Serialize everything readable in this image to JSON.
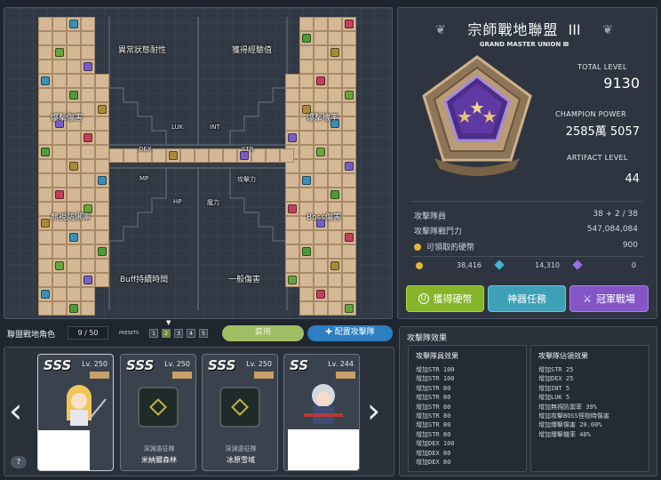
{
  "board": {
    "zones": {
      "abnormal_resist": "異常狀態耐性",
      "exp_gain": "獲得經驗值",
      "crit_damage": "爆擊傷害",
      "crit_rate": "爆擊機率",
      "luk": "LUK",
      "int": "INT",
      "dex": "DEX",
      "str": "STR",
      "mp": "MP",
      "atk": "攻擊力",
      "hp": "HP",
      "matk": "魔力",
      "ignore_def": "無視防禦率",
      "boss_damage": "Boss傷害",
      "buff_duration": "Buff持續時間",
      "normal_damage": "一般傷害"
    }
  },
  "union": {
    "title": "宗師戰地聯盟",
    "rank_numeral": "III",
    "subtitle": "GRAND MASTER UNION Ⅲ",
    "total_level_label": "TOTAL LEVEL",
    "total_level": "9130",
    "champion_power_label": "CHAMPION POWER",
    "champion_power": "2585萬 5057",
    "artifact_level_label": "ARTIFACT LEVEL",
    "artifact_level": "44"
  },
  "stats": {
    "members_label": "攻擊隊員",
    "members_value": "38 + 2 / 38",
    "power_label": "攻擊隊戰鬥力",
    "power_value": "547,084,084",
    "coins_label": "可領取的硬幣",
    "coins_value": "900",
    "currency_1": "38,416",
    "currency_2": "14,310",
    "currency_3": "0"
  },
  "buttons": {
    "get_coins": "獲得硬幣",
    "artifact_quest": "神器任務",
    "champion_battle": "冠軍戰場",
    "apply": "套用",
    "arrange": "配置攻擊隊"
  },
  "char_bar": {
    "label": "聯盟戰地角色",
    "count": "9 / 50",
    "presets_label": "PRESETS",
    "presets": [
      "1",
      "2",
      "3",
      "4",
      "5"
    ]
  },
  "cards": [
    {
      "grade": "SSS",
      "level": "Lv. 250",
      "subtitle": "",
      "name": ""
    },
    {
      "grade": "SSS",
      "level": "Lv. 250",
      "subtitle": "深淵遠征隊",
      "name": "米納爾森林"
    },
    {
      "grade": "SSS",
      "level": "Lv. 250",
      "subtitle": "深淵遠征隊",
      "name": "冰原雪域"
    },
    {
      "grade": "SS",
      "level": "Lv. 244",
      "subtitle": "",
      "name": ""
    }
  ],
  "effects": {
    "title": "攻擊隊效果",
    "member_title": "攻擊隊員效果",
    "member_list": [
      "增加STR 100",
      "增加STR 100",
      "增加STR 80",
      "增加STR 80",
      "增加STR 80",
      "增加STR 80",
      "增加STR 80",
      "增加STR 80",
      "增加DEX 100",
      "增加DEX 80",
      "增加DEX 80"
    ],
    "occupy_title": "攻擊隊佔領效果",
    "occupy_list": [
      "增加STR 25",
      "增加DEX 25",
      "增加INT 5",
      "增加LUK 5",
      "增加無視防禦率 39%",
      "增加攻擊BOSS怪物時傷害",
      "增加爆擊傷害 20.00%",
      "增加爆擊機率 40%"
    ]
  },
  "help": "?",
  "colors": {
    "gold": "#d5b896",
    "green_btn": "#86b52a",
    "teal_btn": "#3fa1b8",
    "purple_btn": "#8355c7",
    "blue_btn": "#2d7fc1"
  },
  "icons": [
    "union-emblem-icon",
    "coin-icon",
    "blue-gem-icon",
    "purple-gem-icon",
    "arrow-left-icon",
    "arrow-right-icon",
    "sword-icon",
    "help-icon"
  ]
}
